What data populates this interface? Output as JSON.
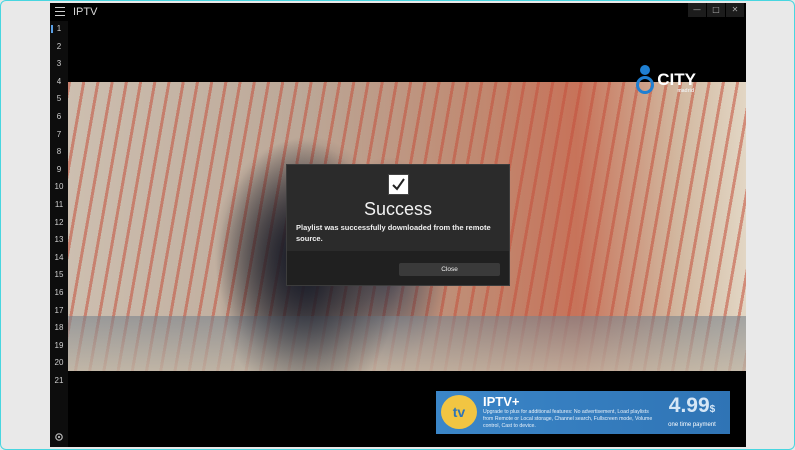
{
  "window": {
    "title": "IPTV",
    "controls": [
      "—",
      "□",
      "✕"
    ]
  },
  "sidebar": {
    "channels": [
      "1",
      "2",
      "3",
      "4",
      "5",
      "6",
      "7",
      "8",
      "9",
      "10",
      "11",
      "12",
      "13",
      "14",
      "15",
      "16",
      "17",
      "18",
      "19",
      "20",
      "21"
    ],
    "active_index": 0,
    "settings_icon": "gear-icon"
  },
  "overlay_logo": {
    "brand": "CITY",
    "sub": "madrid"
  },
  "dialog": {
    "title": "Success",
    "message": "Playlist was successfully downloaded from the remote source.",
    "close_label": "Close",
    "icon": "checkmark-icon"
  },
  "promo": {
    "logo_text": "tv",
    "title": "IPTV+",
    "description": "Upgrade to plus for additional features: No advertisement, Load playlists from Remote or Local storage, Channel search, Fullscreen mode, Volume control, Cast to device.",
    "price": "4.99",
    "currency": "$",
    "price_note": "one time payment"
  },
  "colors": {
    "accent": "#5aa0e6",
    "promo_blue": "#3b86c8",
    "dialog_bg": "#2b2b2b",
    "frame_border": "#48d6e0"
  }
}
